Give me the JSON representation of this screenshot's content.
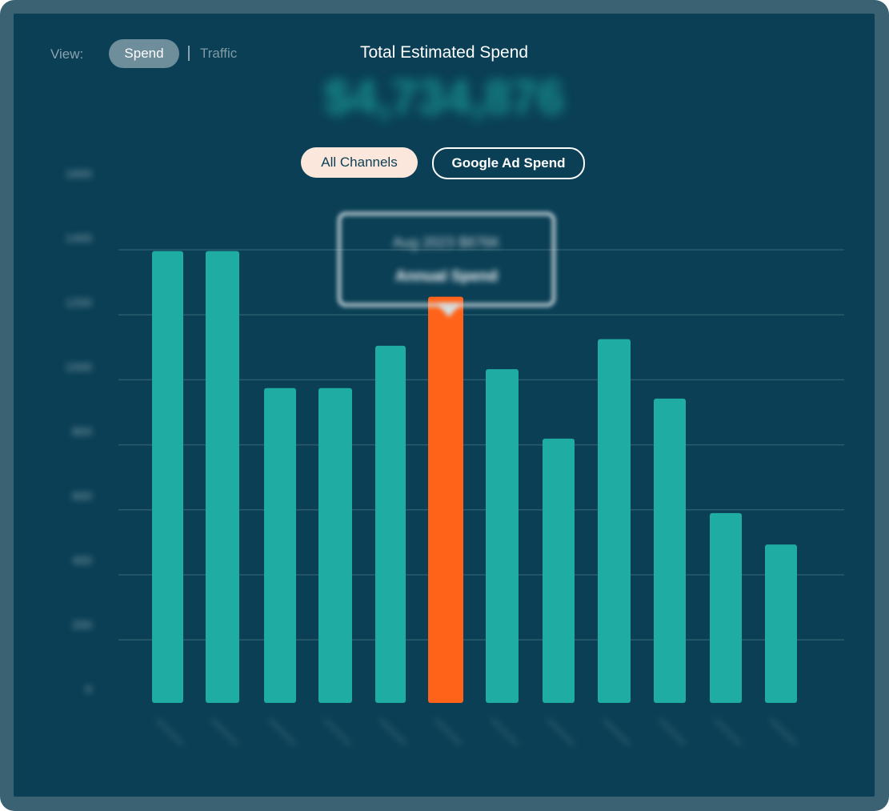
{
  "view": {
    "label": "View:",
    "active": "Spend",
    "other": "Traffic"
  },
  "header": {
    "title": "Total Estimated Spend",
    "total": "$4,734,876"
  },
  "filters": {
    "all_channels": "All Channels",
    "google_ad_spend": "Google Ad Spend"
  },
  "tooltip": {
    "line1": "Aug 2023 $876K",
    "line2": "Annual Spend"
  },
  "colors": {
    "bar": "#1eaca3",
    "highlight": "#ff6319",
    "grid": "#2a5c6e",
    "background": "#0a3f55"
  },
  "chart_data": {
    "type": "bar",
    "categories": [
      "",
      "",
      "",
      "",
      "",
      "",
      "",
      "",
      "",
      "",
      "",
      ""
    ],
    "values": [
      1366,
      1366,
      952,
      952,
      1080,
      1228,
      1009,
      799,
      1100,
      920,
      574,
      479
    ],
    "highlight_index": 5,
    "yticks": [
      "1600",
      "1400",
      "1200",
      "1000",
      "800",
      "600",
      "400",
      "200",
      "0"
    ],
    "ylim": [
      0,
      1600
    ],
    "grid": true,
    "title": "",
    "xlabel": "",
    "ylabel": ""
  }
}
